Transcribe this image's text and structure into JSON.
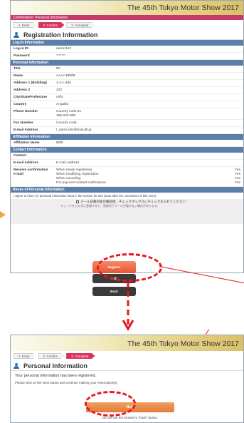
{
  "colors": {
    "accent": "#d9335f",
    "section": "#5b7fa8",
    "annotation": "#e8161d",
    "register": "#e85530"
  },
  "screen1": {
    "banner": "The 45th Tokyo Motor Show 2017",
    "breadcrumb": "Confirmation: Personal Information",
    "steps": [
      "1. Entry",
      "2. Confirm",
      "3. Complete"
    ],
    "page_title": "Registration Information",
    "sections": {
      "login": {
        "title": "Log-In Information",
        "rows": [
          {
            "label": "Log-in ID",
            "value": "aarro1113"
          },
          {
            "label": "Password",
            "value": "*******"
          }
        ]
      },
      "personal": {
        "title": "Personal Information",
        "rows": [
          {
            "label": "Title",
            "value": "Mr."
          },
          {
            "label": "Name",
            "value": "AAAA BBBB"
          },
          {
            "label": "Address 1 (Building)",
            "value": "1-2-1-ddd"
          },
          {
            "label": "Address 2",
            "value": "222"
          },
          {
            "label": "City/State/Prefecture",
            "value": "nrffo"
          },
          {
            "label": "Country",
            "value": "Anguilla"
          },
          {
            "label": "Phone Number",
            "value": "Country code:91\n156-222-999"
          },
          {
            "label": "Fax Number",
            "value": "Country code:"
          },
          {
            "label": "E-mail Address",
            "value": "t_aarro-ohs@bwd.jlb.jp"
          }
        ]
      },
      "affiliation": {
        "title": "Affiliation Information",
        "rows": [
          {
            "label": "Affiliation Name",
            "value": "BBB"
          }
        ]
      },
      "contact": {
        "title": "Contact Information",
        "rows": [
          {
            "label": "Contact",
            "value": ""
          },
          {
            "label": "E-mail Address",
            "value": "E-mail Address"
          },
          {
            "label": "Receive confirmation\ne-mail",
            "value": "When newly registering\nWhen modifying registration\nWhen canceling\nFor payment-related notifications",
            "yes": "Yes\nYes\nYes\nYes"
          }
        ]
      },
      "reuse": {
        "title": "Reuse of Personal Information"
      }
    },
    "consent": "I agree to have my personal information kept in the system for two years after the conclusion of this event.",
    "checkbox_label": "メール記載内容の確認後、チェックボックスにチェックを入れてください",
    "checkbox_label2": "チェックを入れずに登録すると、登録完了メールが届かない場合があります。",
    "buttons": {
      "register": "Register",
      "edit": "Edit",
      "back": "Back"
    }
  },
  "screen2": {
    "banner": "The 45th Tokyo Motor Show 2017",
    "steps": [
      "1. Entry",
      "2. Confirm",
      "3. Complete"
    ],
    "page_title": "Personal Information",
    "message": "Your personal information has been registered.",
    "instruction": "Please click on the Next button and continue making your reservation(s).",
    "next_button": "Next",
    "back_note": "Do not use the browser's \"back\" button."
  }
}
